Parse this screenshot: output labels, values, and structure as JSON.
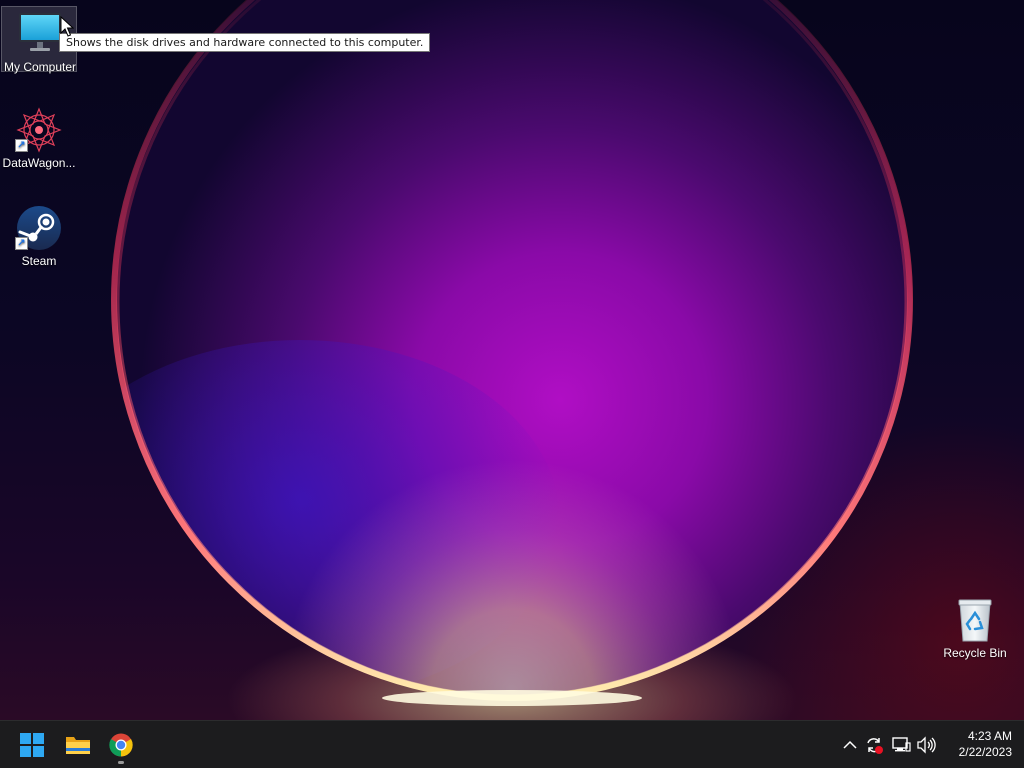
{
  "desktop": {
    "icons": [
      {
        "label": "My Computer",
        "icon": "monitor-icon",
        "selected": true
      },
      {
        "label": "DataWagon...",
        "icon": "datawagon-logo-icon",
        "shortcut": true
      },
      {
        "label": "Steam",
        "icon": "steam-icon",
        "shortcut": true
      },
      {
        "label": "Recycle Bin",
        "icon": "recycle-bin-icon"
      }
    ],
    "tooltip": "Shows the disk drives and hardware connected to this computer."
  },
  "taskbar": {
    "pinned": [
      {
        "name": "Start",
        "icon": "windows-start-icon"
      },
      {
        "name": "File Explorer",
        "icon": "folder-icon"
      },
      {
        "name": "Google Chrome",
        "icon": "chrome-icon",
        "running": true
      }
    ],
    "tray": [
      {
        "icon": "chevron-up-icon"
      },
      {
        "icon": "sync-alert-icon"
      },
      {
        "icon": "network-icon"
      },
      {
        "icon": "volume-icon"
      }
    ],
    "clock": {
      "time": "4:23 AM",
      "date": "2/22/2023"
    }
  },
  "colors": {
    "taskbar": "#1c1c1e",
    "orb_core": "#b00ec4",
    "orb_rim": "#ff4a6a",
    "glow": "#ffe9a8",
    "windows_blue": "#2ea8f2"
  }
}
